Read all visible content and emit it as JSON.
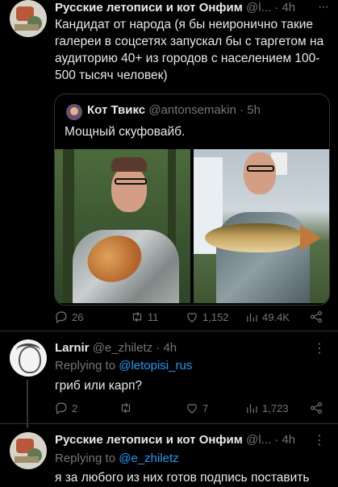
{
  "tweet1": {
    "name": "Русские летописи и кот Онфим",
    "handle": "@l...",
    "time": "· 4h",
    "more": "···",
    "text": "Кандидат от народа (я бы неиронично такие галереи в соцсетях запускал бы с таргетом на аудиторию 40+ из городов с населением 100-500 тысяч человек)",
    "quote": {
      "name": "Кот Твикс",
      "handle": "@antonsemakin · 5h",
      "text": "Мощный скуфовайб."
    },
    "stats": {
      "replies": "26",
      "retweets": "11",
      "likes": "1,152",
      "views": "49.4K"
    }
  },
  "tweet2": {
    "name": "Larnir",
    "handle": "@e_zhiletz · 4h",
    "more": "⋮",
    "reply_prefix": "Replying to",
    "reply_to": "@letopisi_rus",
    "text": "гриб или карп?",
    "stats": {
      "replies": "2",
      "retweets": "",
      "likes": "7",
      "views": "1,723"
    }
  },
  "tweet3": {
    "name": "Русские летописи и кот Онфим",
    "handle": "@l...",
    "time": "· 4h",
    "more": "⋮",
    "reply_prefix": "Replying to",
    "reply_to": "@e_zhiletz",
    "text": "я за любого из них готов подпись поставить"
  },
  "colors": {
    "background": "#000000",
    "text": "#e7e9ea",
    "muted": "#71767b",
    "link": "#1d9bf0",
    "border": "#2f3336"
  }
}
